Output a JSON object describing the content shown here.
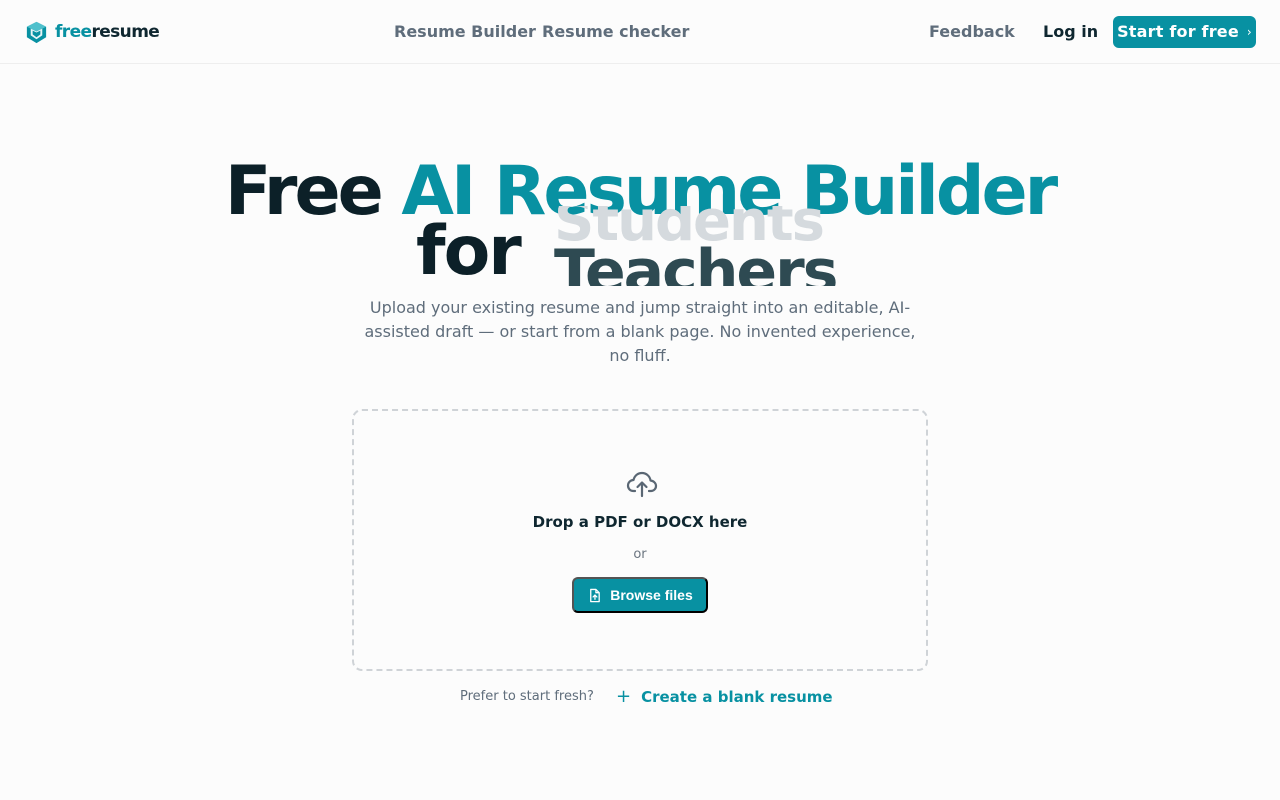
{
  "header": {
    "logo": {
      "part1": "free",
      "part2": "resume",
      "icon": "box-logo-icon"
    },
    "nav": [
      {
        "label": "Resume Builder"
      },
      {
        "label": "Resume checker"
      }
    ],
    "feedback_label": "Feedback",
    "login_label": "Log in",
    "start_label": "Start for free",
    "start_icon": "chevron-right-icon"
  },
  "hero": {
    "word_free": "Free",
    "title_accent": "AI Resume Builder",
    "word_for": "for",
    "rotating_prev": "Students",
    "rotating_current": "Teachers",
    "subtitle": "Upload your existing resume and jump straight into an editable, AI-assisted draft — or start from a blank page. No invented experience, no fluff."
  },
  "upload": {
    "icon": "cloud-upload-icon",
    "title": "Drop a PDF or DOCX here",
    "or": "or",
    "browse_label": "Browse files",
    "browse_icon": "file-upload-icon"
  },
  "footer": {
    "prefer_text": "Prefer to start fresh?",
    "create_label": "Create a blank resume",
    "create_icon": "plus-icon"
  },
  "colors": {
    "accent": "#0891a2",
    "text_dark": "#0f2730",
    "text_muted": "#5f6d7b",
    "background": "#fcfcfc"
  }
}
